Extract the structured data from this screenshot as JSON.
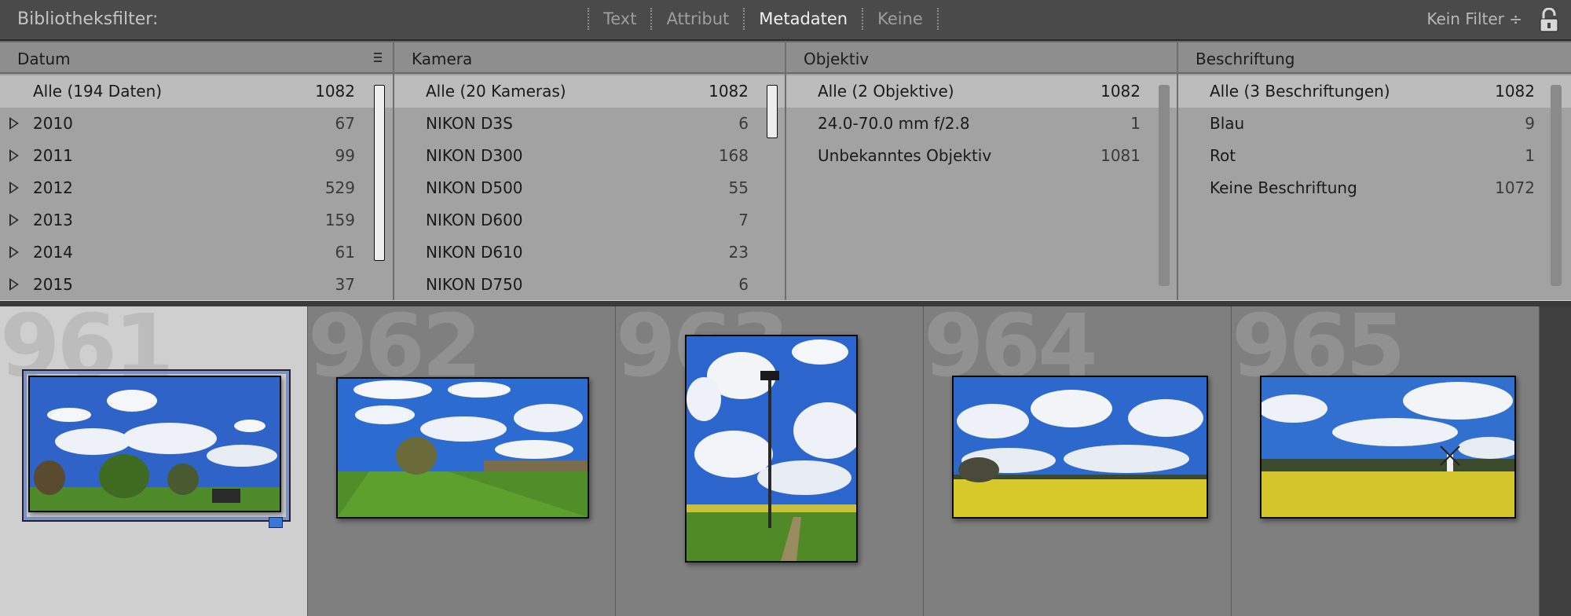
{
  "filterbar": {
    "title": "Bibliotheksfilter:",
    "modes": [
      "Text",
      "Attribut",
      "Metadaten",
      "Keine"
    ],
    "active_mode": "Metadaten",
    "preset": "Kein Filter ÷",
    "lock_icon": "lock-open-icon"
  },
  "columns": [
    {
      "header": "Datum",
      "rows": [
        {
          "label": "Alle (194 Daten)",
          "count": "1082"
        },
        {
          "label": "2010",
          "count": "67"
        },
        {
          "label": "2011",
          "count": "99"
        },
        {
          "label": "2012",
          "count": "529"
        },
        {
          "label": "2013",
          "count": "159"
        },
        {
          "label": "2014",
          "count": "61"
        },
        {
          "label": "2015",
          "count": "37"
        }
      ]
    },
    {
      "header": "Kamera",
      "rows": [
        {
          "label": "Alle (20 Kameras)",
          "count": "1082"
        },
        {
          "label": "NIKON D3S",
          "count": "6"
        },
        {
          "label": "NIKON D300",
          "count": "168"
        },
        {
          "label": "NIKON D500",
          "count": "55"
        },
        {
          "label": "NIKON D600",
          "count": "7"
        },
        {
          "label": "NIKON D610",
          "count": "23"
        },
        {
          "label": "NIKON D750",
          "count": "6"
        }
      ]
    },
    {
      "header": "Objektiv",
      "rows": [
        {
          "label": "Alle (2 Objektive)",
          "count": "1082"
        },
        {
          "label": "24.0-70.0 mm f/2.8",
          "count": "1"
        },
        {
          "label": "Unbekanntes Objektiv",
          "count": "1081"
        }
      ]
    },
    {
      "header": "Beschriftung",
      "rows": [
        {
          "label": "Alle (3 Beschriftungen)",
          "count": "1082"
        },
        {
          "label": "Blau",
          "count": "9"
        },
        {
          "label": "Rot",
          "count": "1"
        },
        {
          "label": "Keine Beschriftung",
          "count": "1072"
        }
      ]
    }
  ],
  "grid": {
    "cells": [
      {
        "number": "961",
        "selected": true,
        "label_color": "#3a76d6"
      },
      {
        "number": "962",
        "selected": false
      },
      {
        "number": "963",
        "selected": false
      },
      {
        "number": "964",
        "selected": false
      },
      {
        "number": "965",
        "selected": false
      }
    ]
  },
  "colors": {
    "selection_frame": "#7d93c6",
    "blue_label": "#3a76d6",
    "sky": "#2f63c8",
    "rapeseed": "#d8c92a",
    "grass": "#4e8a2a"
  }
}
